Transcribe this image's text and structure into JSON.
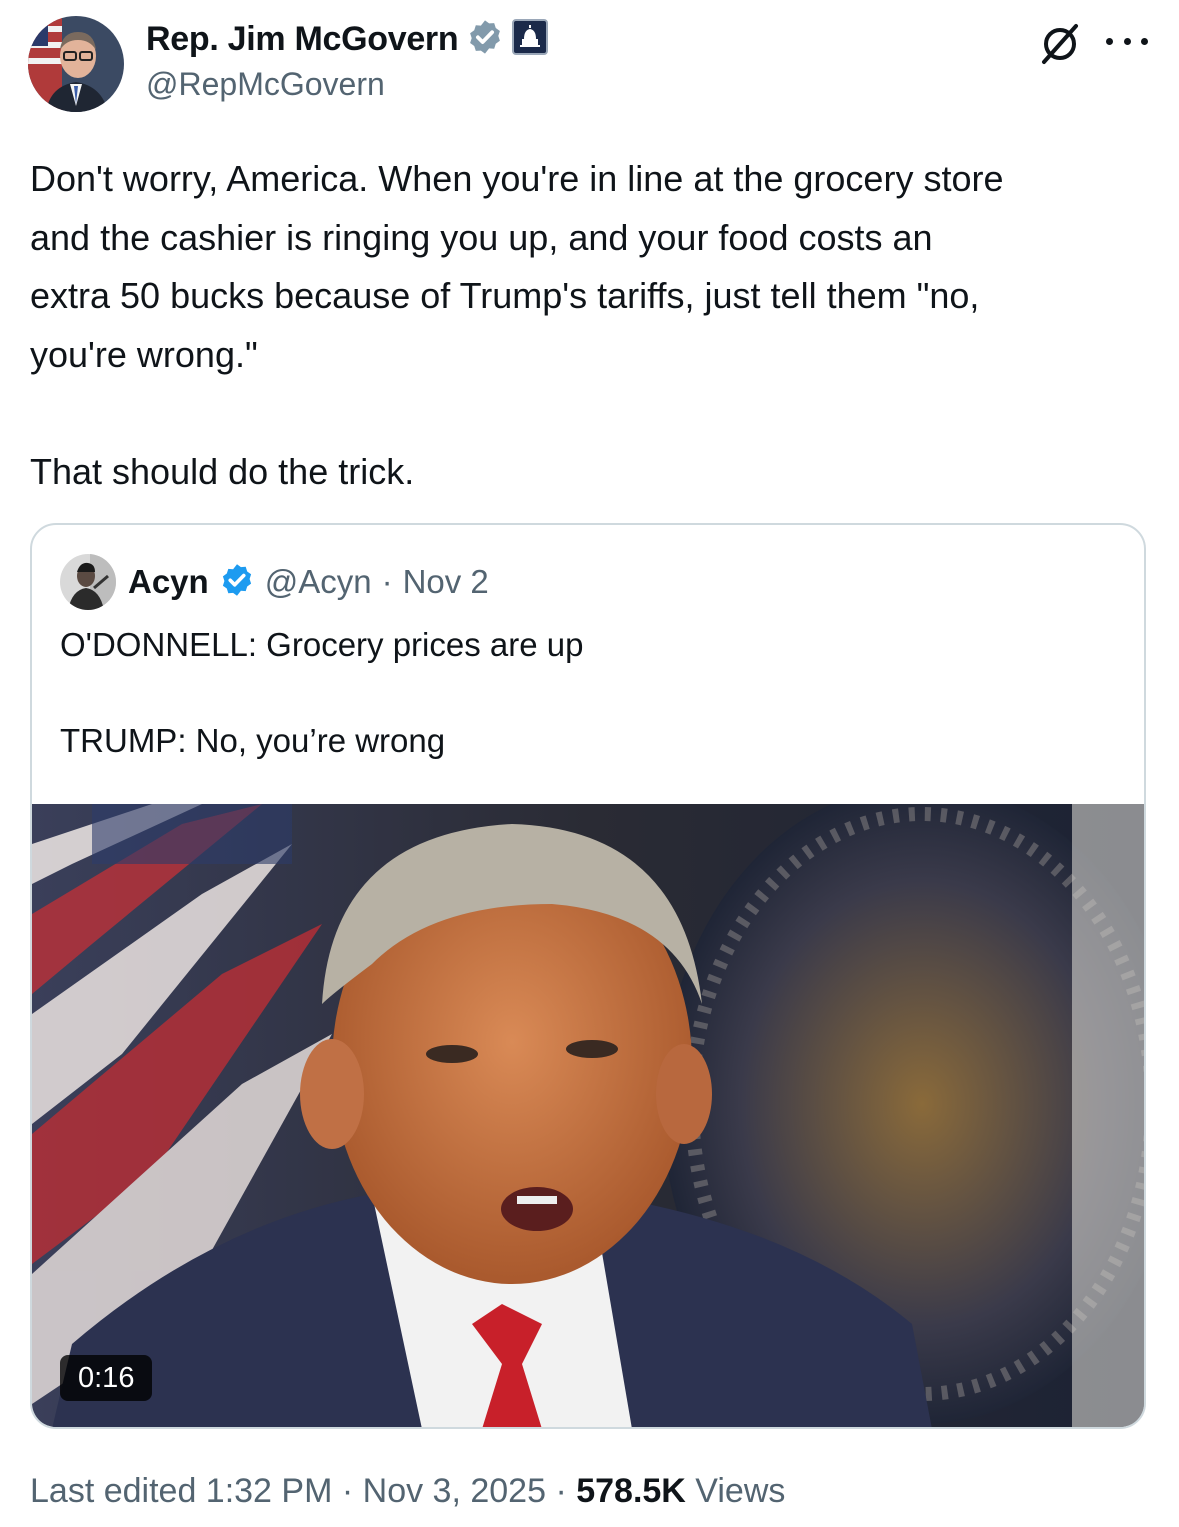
{
  "author": {
    "name": "Rep. Jim McGovern",
    "handle": "@RepMcGovern",
    "verified_badge_color": "#829aab",
    "affiliation_icon": "capitol-badge-icon"
  },
  "tweet": {
    "text": "Don't worry, America. When you're in line at the grocery store\nand the cashier is ringing you up, and your food costs an\nextra 50 bucks because of Trump's tariffs, just tell them \"no,\nyou're wrong.\"\n\nThat should do the trick."
  },
  "quote": {
    "name": "Acyn",
    "handle": "@Acyn",
    "separator": "·",
    "date": "Nov 2",
    "verified_badge_color": "#1d9bf0",
    "text": "O'DONNELL: Grocery prices are up\n\nTRUMP: No, you’re wrong",
    "video_duration": "0:16"
  },
  "footer": {
    "edited_prefix": "Last edited ",
    "time": "1:32 PM",
    "sep1": " · ",
    "date": "Nov 3, 2025",
    "sep2": " · ",
    "views_count": "578.5K",
    "views_label": " Views"
  },
  "icons": {
    "grok": "grok-icon",
    "more": "more-options-icon"
  }
}
